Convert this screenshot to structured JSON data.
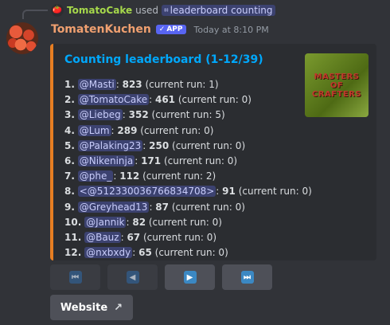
{
  "reply": {
    "avatar_icon": "tomato-avatar-icon",
    "user": "TomatoCake",
    "used_text": "used",
    "command": "leaderboard counting"
  },
  "message": {
    "author": "TomatenKuchen",
    "badge": "APP",
    "timestamp": "Today at 8:10 PM"
  },
  "embed": {
    "accent_color": "#e67e22",
    "title": "Counting leaderboard (1-12/39)",
    "thumbnail_text": [
      "MASTERS",
      "OF",
      "CRAFTERS"
    ],
    "rows": [
      {
        "rank": "1.",
        "user": "@Masti",
        "score": "823",
        "run": "(current run: 1)"
      },
      {
        "rank": "2.",
        "user": "@TomatoCake",
        "score": "461",
        "run": "(current run: 0)"
      },
      {
        "rank": "3.",
        "user": "@Liebeg",
        "score": "352",
        "run": "(current run: 5)"
      },
      {
        "rank": "4.",
        "user": "@Lum",
        "score": "289",
        "run": "(current run: 0)"
      },
      {
        "rank": "5.",
        "user": "@Palaking23",
        "score": "250",
        "run": "(current run: 0)"
      },
      {
        "rank": "6.",
        "user": "@Nikeninja",
        "score": "171",
        "run": "(current run: 0)"
      },
      {
        "rank": "7.",
        "user": "@phe_",
        "score": "112",
        "run": "(current run: 2)"
      },
      {
        "rank": "8.",
        "user": "<@512330036766834708>",
        "score": "91",
        "run": "(current run: 0)"
      },
      {
        "rank": "9.",
        "user": "@Greyhead13",
        "score": "87",
        "run": "(current run: 0)"
      },
      {
        "rank": "10.",
        "user": "@Jannik",
        "score": "82",
        "run": "(current run: 0)"
      },
      {
        "rank": "11.",
        "user": "@Bauz",
        "score": "67",
        "run": "(current run: 0)"
      },
      {
        "rank": "12.",
        "user": "@nxbxdy",
        "score": "65",
        "run": "(current run: 0)"
      }
    ]
  },
  "buttons": {
    "first_glyph": "⏮",
    "prev_glyph": "◀",
    "next_glyph": "▶",
    "last_glyph": "⏭",
    "website_label": "Website"
  }
}
